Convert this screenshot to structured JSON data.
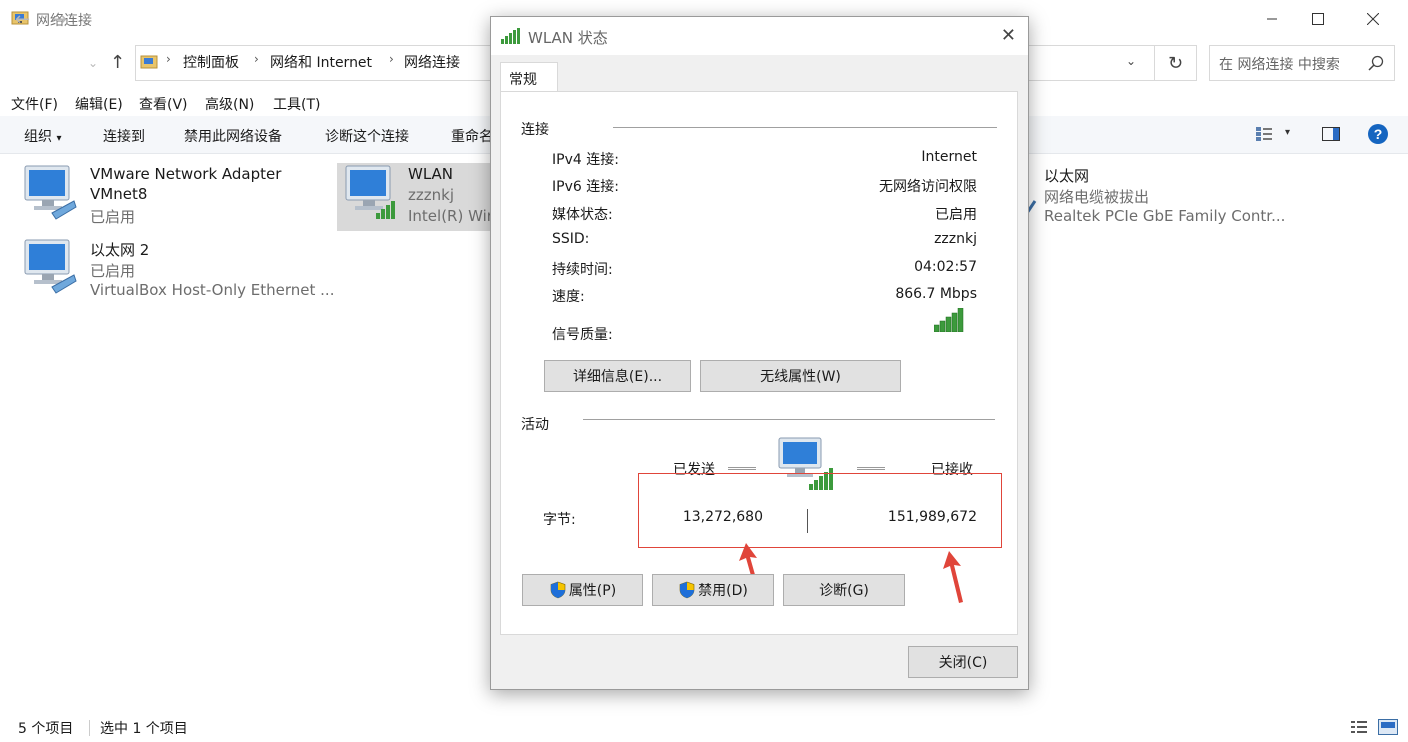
{
  "explorer": {
    "window_title": "网络连接",
    "breadcrumb": [
      "控制面板",
      "网络和 Internet",
      "网络连接"
    ],
    "search_placeholder": "在 网络连接 中搜索",
    "menu": [
      "文件(F)",
      "编辑(E)",
      "查看(V)",
      "高级(N)",
      "工具(T)"
    ],
    "toolbar": {
      "organize": "组织",
      "connect_to": "连接到",
      "disable": "禁用此网络设备",
      "diagnose": "诊断这个连接",
      "rename": "重命名"
    },
    "items": [
      {
        "name": "VMware Network Adapter",
        "name2": "VMnet8",
        "status": "已启用"
      },
      {
        "name": "WLAN",
        "status": "zzznkj",
        "device": "Intel(R) Wire"
      },
      {
        "name": "以太网",
        "status": "网络电缆被拔出",
        "device": "Realtek PCIe GbE Family Contr..."
      },
      {
        "name": "以太网 2",
        "status": "已启用",
        "device": "VirtualBox Host-Only Ethernet ..."
      }
    ],
    "status": {
      "count": "5 个项目",
      "selected": "选中 1 个项目"
    }
  },
  "dialog": {
    "title": "WLAN 状态",
    "tab": "常规",
    "connection_group": "连接",
    "rows": [
      {
        "label": "IPv4 连接:",
        "value": "Internet"
      },
      {
        "label": "IPv6 连接:",
        "value": "无网络访问权限"
      },
      {
        "label": "媒体状态:",
        "value": "已启用"
      },
      {
        "label": "SSID:",
        "value": "zzznkj"
      },
      {
        "label": "持续时间:",
        "value": "04:02:57"
      },
      {
        "label": "速度:",
        "value": "866.7 Mbps"
      }
    ],
    "signal_label": "信号质量:",
    "details_button": "详细信息(E)...",
    "wireless_props_button": "无线属性(W)",
    "activity_group": "活动",
    "sent_label": "已发送",
    "received_label": "已接收",
    "bytes_label": "字节:",
    "bytes_sent": "13,272,680",
    "bytes_received": "151,989,672",
    "properties_button": "属性(P)",
    "disable_button": "禁用(D)",
    "diagnose_button": "诊断(G)",
    "close_button": "关闭(C)"
  },
  "colors": {
    "accent": "#0078d7",
    "signal": "#3c9a3c",
    "annotation": "#e0453a"
  }
}
